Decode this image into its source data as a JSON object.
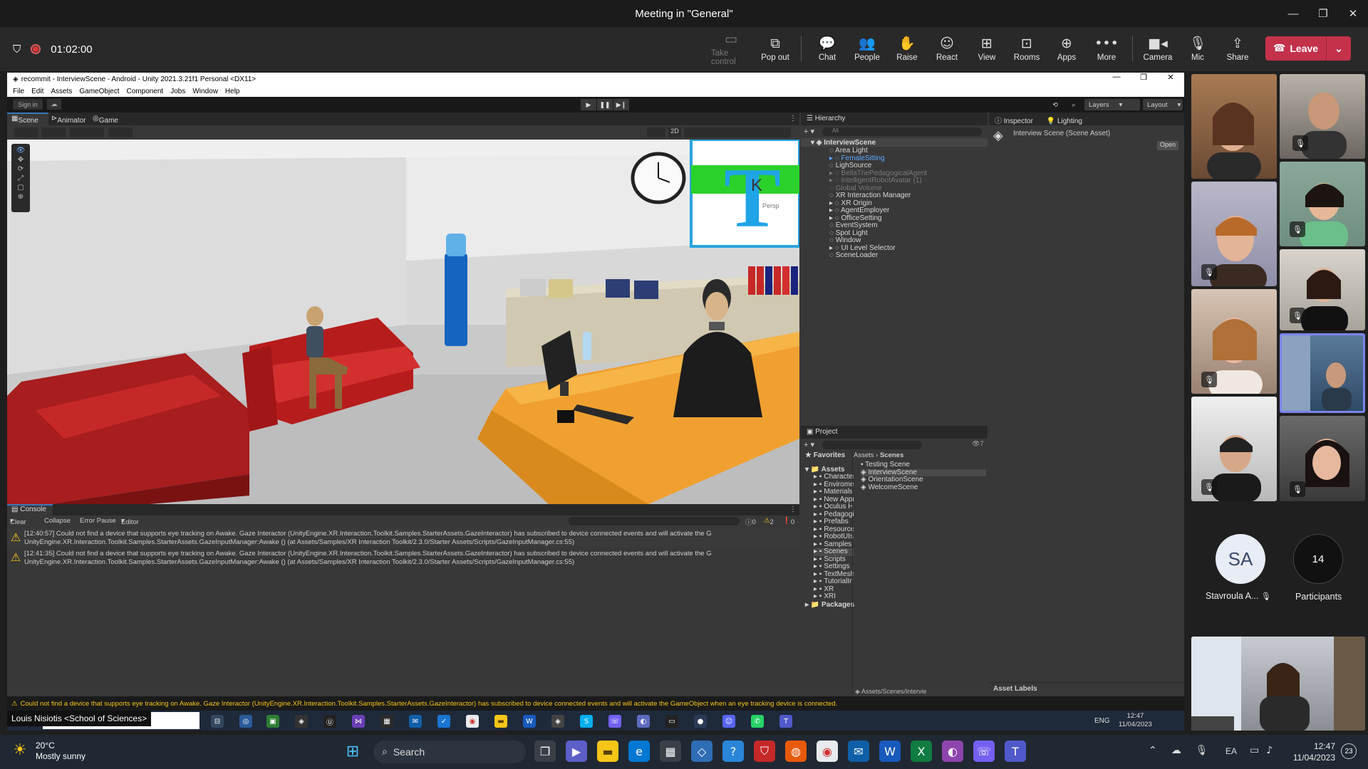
{
  "teams": {
    "window_title": "Meeting in \"General\"",
    "elapsed": "01:02:00",
    "buttons": {
      "take_control": "Take control",
      "pop_out": "Pop out",
      "chat": "Chat",
      "people": "People",
      "raise": "Raise",
      "react": "React",
      "view": "View",
      "rooms": "Rooms",
      "apps": "Apps",
      "more": "More",
      "camera": "Camera",
      "mic": "Mic",
      "share": "Share",
      "leave": "Leave"
    },
    "participant_initials": "SA",
    "participant_name": "Stavroula A...",
    "participant_count": "14",
    "participants_label": "Participants",
    "presenter_name": "Louis Nisiotis <School of Sciences>"
  },
  "unity": {
    "title": "recommit - InterviewScene - Android - Unity 2021.3.21f1 Personal <DX11>",
    "menu": [
      "File",
      "Edit",
      "Assets",
      "GameObject",
      "Component",
      "Jobs",
      "Window",
      "Help"
    ],
    "sign_in": "Sign in",
    "layers": "Layers",
    "layout": "Layout",
    "scene_tabs": [
      "Scene",
      "Animator",
      "Game"
    ],
    "mode_2d": "2D",
    "persp": "Persp",
    "console_tab": "Console",
    "console_buttons": [
      "Clear",
      "Collapse",
      "Error Pause",
      "Editor"
    ],
    "counts": {
      "info": "0",
      "warn": "2",
      "error": "0"
    },
    "logs": [
      {
        "line1": "[12:40:57] Could not find a device that supports eye tracking on Awake. Gaze Interactor (UnityEngine.XR.Interaction.Toolkit.Samples.StarterAssets.GazeInteractor) has subscribed to device connected events and will activate the G",
        "line2": "UnityEngine.XR.Interaction.Toolkit.Samples.StarterAssets.GazeInputManager:Awake () (at Assets/Samples/XR Interaction Toolkit/2.3.0/Starter Assets/Scripts/GazeInputManager.cs:55)"
      },
      {
        "line1": "[12:41:35] Could not find a device that supports eye tracking on Awake. Gaze Interactor (UnityEngine.XR.Interaction.Toolkit.Samples.StarterAssets.GazeInteractor) has subscribed to device connected events and will activate the G",
        "line2": "UnityEngine.XR.Interaction.Toolkit.Samples.StarterAssets.GazeInputManager:Awake () (at Assets/Samples/XR Interaction Toolkit/2.3.0/Starter Assets/Scripts/GazeInputManager.cs:55)"
      }
    ],
    "status_message": "Could not find a device that supports eye tracking on Awake. Gaze Interactor (UnityEngine.XR.Interaction.Toolkit.Samples.StarterAssets.GazeInteractor) has subscribed to device connected events and will activate the GameObject when an eye tracking device is connected.",
    "hierarchy_tab": "Hierarchy",
    "hierarchy_search": "All",
    "hierarchy_root": "InterviewScene",
    "hierarchy": [
      {
        "label": "Area Light",
        "state": "normal"
      },
      {
        "label": "FemaleSitting",
        "state": "selected"
      },
      {
        "label": "LighSource",
        "state": "normal"
      },
      {
        "label": "BellaThePedagogicalAgent",
        "state": "disabled"
      },
      {
        "label": "IntelligentRobotAvatar (1)",
        "state": "disabled"
      },
      {
        "label": "Global Volume",
        "state": "disabled"
      },
      {
        "label": "XR Interaction Manager",
        "state": "normal"
      },
      {
        "label": "XR Origin",
        "state": "normal"
      },
      {
        "label": "AgentEmployer",
        "state": "normal"
      },
      {
        "label": "OfficeSetting",
        "state": "normal"
      },
      {
        "label": "EventSystem",
        "state": "normal"
      },
      {
        "label": "Spot Light",
        "state": "normal"
      },
      {
        "label": "Window",
        "state": "normal"
      },
      {
        "label": "UI Level Selector",
        "state": "normal"
      },
      {
        "label": "SceneLoader",
        "state": "normal"
      }
    ],
    "inspector_tab": "Inspector",
    "lighting_tab": "Lighting",
    "inspector_title": "Interview Scene (Scene Asset)",
    "open_button": "Open",
    "asset_labels": "Asset Labels",
    "project_tab": "Project",
    "favorites": "Favorites",
    "assets_root": "Assets",
    "asset_folders": [
      "Characters",
      "Enviroment",
      "Materials",
      "New Appro",
      "Oculus Har",
      "Pedagogic",
      "Prefabs",
      "Resources",
      "RobotUIs",
      "Samples",
      "Scenes",
      "Scripts",
      "Settings",
      "TextMesh I",
      "TutorialInfo",
      "XR",
      "XRI"
    ],
    "packages": "Packages",
    "breadcrumb": [
      "Assets",
      "Scenes"
    ],
    "scene_files": [
      "Testing Scene",
      "InterviewScene",
      "OrientationScene",
      "WelcomeScene"
    ],
    "path_footer": "Assets/Scenes/Intervie",
    "hidden_count": "7"
  },
  "inner_taskbar": {
    "search": "Type here to search",
    "time": "12:47",
    "date": "11/04/2023",
    "lang": "ENG"
  },
  "windows": {
    "weather_temp": "20°C",
    "weather_desc": "Mostly sunny",
    "search": "Search",
    "lang": "EA",
    "time": "12:47",
    "date": "11/04/2023",
    "notifications": "23"
  },
  "colors": {
    "leave": "#c4314b",
    "selection": "#5ea8ff",
    "warning": "#f5c518"
  }
}
